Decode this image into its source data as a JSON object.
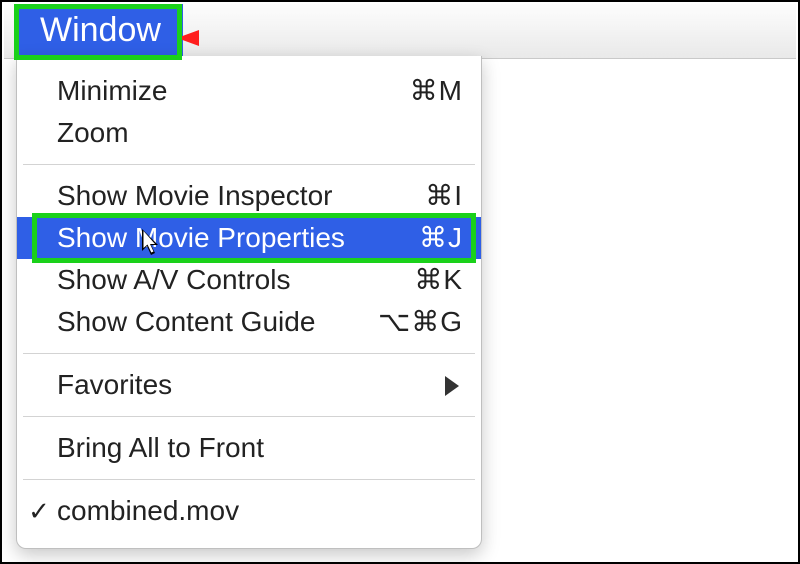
{
  "menubar": {
    "title": "Window"
  },
  "menu": {
    "minimize": {
      "label": "Minimize",
      "shortcut": "⌘M"
    },
    "zoom": {
      "label": "Zoom",
      "shortcut": ""
    },
    "inspector": {
      "label": "Show Movie Inspector",
      "shortcut": "⌘I"
    },
    "properties": {
      "label": "Show Movie Properties",
      "shortcut": "⌘J"
    },
    "av": {
      "label": "Show A/V Controls",
      "shortcut": "⌘K"
    },
    "guide": {
      "label": "Show Content Guide",
      "shortcut": "⌥⌘G"
    },
    "favorites": {
      "label": "Favorites",
      "shortcut": ""
    },
    "front": {
      "label": "Bring All to Front",
      "shortcut": ""
    },
    "doc": {
      "label": "combined.mov",
      "shortcut": "",
      "checked": "✓"
    }
  }
}
